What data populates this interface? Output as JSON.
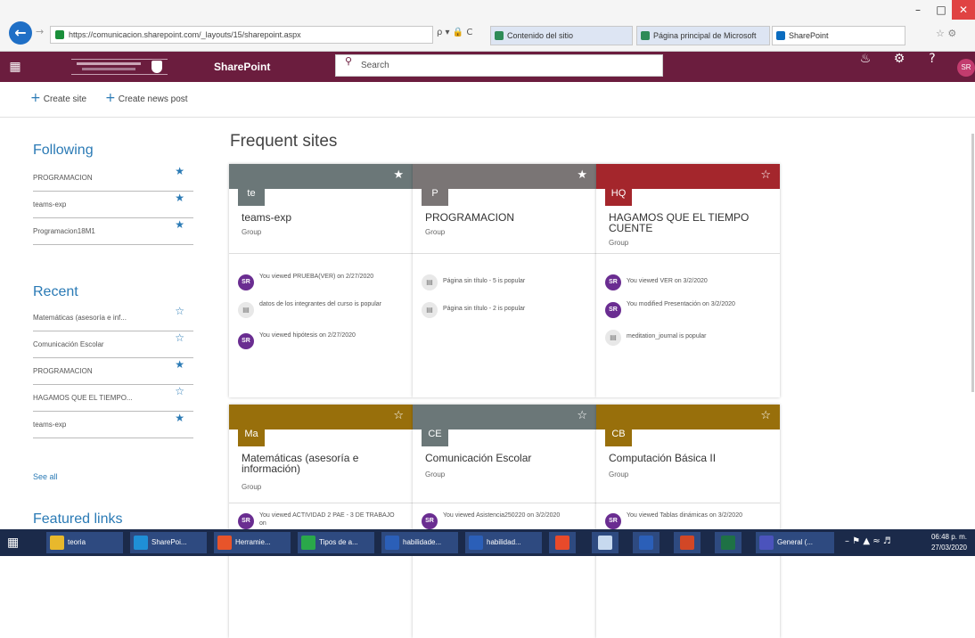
{
  "browser": {
    "address": "https://comunicacion.sharepoint.com/_layouts/15/sharepoint.aspx",
    "address_tools": "ρ ▾ 🔒 C",
    "tabs": [
      {
        "label": "Contenido del sitio",
        "color": "#2e8b57",
        "active": false
      },
      {
        "label": "Página principal de Microsoft",
        "color": "#2e8b57",
        "active": false
      },
      {
        "label": "SharePoint",
        "color": "#0b6cbf",
        "active": true
      }
    ],
    "window_controls": [
      "–",
      "□",
      "✕"
    ]
  },
  "suitebar": {
    "brand": "SharePoint",
    "search_placeholder": "Search",
    "avatar_initials": "SR",
    "icons": [
      "bell-icon",
      "gear-icon",
      "help-icon"
    ]
  },
  "commands": {
    "create_site": "Create site",
    "create_news": "Create news post"
  },
  "left_nav": {
    "following_title": "Following",
    "following": [
      "PROGRAMACION",
      "teams-exp",
      "Programacion18M1"
    ],
    "recent_title": "Recent",
    "recent": [
      {
        "label": "Matemáticas (asesoría e inf...",
        "starred": false
      },
      {
        "label": "Comunicación Escolar",
        "starred": false
      },
      {
        "label": "PROGRAMACION",
        "starred": true
      },
      {
        "label": "HAGAMOS QUE EL TIEMPO...",
        "starred": false
      },
      {
        "label": "teams-exp",
        "starred": true
      }
    ],
    "see_all": "See all",
    "featured_title": "Featured links"
  },
  "frequent": {
    "title": "Frequent sites",
    "cards": [
      {
        "initials": "te",
        "name": "teams-exp",
        "type": "Group",
        "color": "#6b7778",
        "starred": true,
        "activities": [
          {
            "kind": "avatar",
            "text": "You viewed PRUEBA(VER) on 2/27/2020"
          },
          {
            "kind": "doc",
            "text": "datos de los integrantes del curso is popular"
          },
          {
            "kind": "avatar",
            "text": "You viewed hipótesis on 2/27/2020"
          }
        ]
      },
      {
        "initials": "P",
        "name": "PROGRAMACION",
        "type": "Group",
        "color": "#7a7575",
        "starred": true,
        "activities": [
          {
            "kind": "doc",
            "text": "Página sin título - 5 is popular"
          },
          {
            "kind": "doc",
            "text": "Página sin título - 2 is popular"
          }
        ]
      },
      {
        "initials": "HQ",
        "name": "HAGAMOS QUE EL TIEMPO CUENTE",
        "type": "Group",
        "color": "#a4262c",
        "starred": false,
        "activities": [
          {
            "kind": "avatar",
            "text": "You viewed VER on 3/2/2020"
          },
          {
            "kind": "avatar",
            "text": "You modified Presentación on 3/2/2020"
          },
          {
            "kind": "doc",
            "text": "meditation_journal is popular"
          }
        ]
      },
      {
        "initials": "Ma",
        "name": "Matemáticas (asesoría e información)",
        "type": "Group",
        "color": "#986f0b",
        "starred": false,
        "activities": [
          {
            "kind": "avatar",
            "text": "You viewed ACTIVIDAD 2 PAE - 3 DE TRABAJO on"
          }
        ]
      },
      {
        "initials": "CE",
        "name": "Comunicación Escolar",
        "type": "Group",
        "color": "#6b7778",
        "starred": false,
        "activities": [
          {
            "kind": "avatar",
            "text": "You viewed Asistencia250220 on 3/2/2020"
          }
        ]
      },
      {
        "initials": "CB",
        "name": "Computación Básica II",
        "type": "Group",
        "color": "#986f0b",
        "starred": false,
        "activities": [
          {
            "kind": "avatar",
            "text": "You viewed Tablas dinámicas on 3/2/2020"
          }
        ]
      }
    ]
  },
  "taskbar": {
    "items": [
      {
        "label": "teoria",
        "color": "#e8b82c"
      },
      {
        "label": "SharePoi...",
        "color": "#1f8fd6"
      },
      {
        "label": "Herramie...",
        "color": "#e8542a"
      },
      {
        "label": "Tipos de a...",
        "color": "#2aa84a"
      },
      {
        "label": "habilidade...",
        "color": "#2b5fb8"
      },
      {
        "label": "habilidad...",
        "color": "#2b5fb8"
      },
      {
        "label": "",
        "color": "#e84a2a"
      },
      {
        "label": "",
        "color": "#c7d9ef"
      },
      {
        "label": "",
        "color": "#2b5fb8"
      },
      {
        "label": "",
        "color": "#d24726"
      },
      {
        "label": "",
        "color": "#1e7145"
      },
      {
        "label": "General (...",
        "color": "#4b53bc"
      }
    ],
    "time": "06:48 p. m.",
    "date": "27/03/2020"
  }
}
